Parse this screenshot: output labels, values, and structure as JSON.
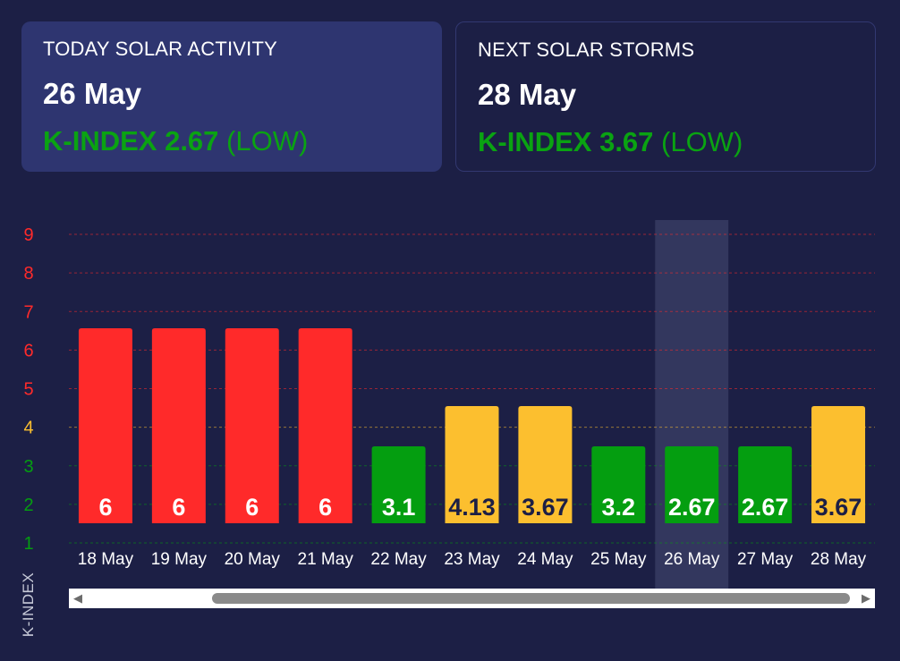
{
  "today_card": {
    "title": "TODAY SOLAR ACTIVITY",
    "date": "26 May",
    "k_label": "K-INDEX",
    "k_value": "2.67",
    "k_class": "(LOW)"
  },
  "next_card": {
    "title": "NEXT SOLAR STORMS",
    "date": "28 May",
    "k_label": "K-INDEX",
    "k_value": "3.67",
    "k_class": "(LOW)"
  },
  "colors": {
    "background": "#1c1f45",
    "card_active": "#2e3570",
    "red": "#ff2a2a",
    "yellow": "#fcbf2f",
    "green": "#049e10",
    "highlight": "#33375e"
  },
  "chart_data": {
    "type": "bar",
    "categories": [
      "18 May",
      "19 May",
      "20 May",
      "21 May",
      "22 May",
      "23 May",
      "24 May",
      "25 May",
      "26 May",
      "27 May",
      "28 May"
    ],
    "values": [
      6,
      6,
      6,
      6,
      3.1,
      4.13,
      3.67,
      3.2,
      2.67,
      2.67,
      3.67
    ],
    "value_labels": [
      "6",
      "6",
      "6",
      "6",
      "3.1",
      "4.13",
      "3.67",
      "3.2",
      "2.67",
      "2.67",
      "3.67"
    ],
    "bar_colors": [
      "red",
      "red",
      "red",
      "red",
      "green",
      "yellow",
      "yellow",
      "green",
      "green",
      "green",
      "yellow"
    ],
    "highlighted_category": "26 May",
    "ylabel": "K-INDEX",
    "yticks": [
      1,
      2,
      3,
      4,
      5,
      6,
      7,
      8,
      9
    ],
    "ytick_colors": [
      "green",
      "green",
      "green",
      "yellow",
      "red",
      "red",
      "red",
      "red",
      "red"
    ],
    "ylim": [
      1,
      9
    ],
    "grid": true
  },
  "scrollbar": {
    "left_arrow": "◀",
    "right_arrow": "▶"
  }
}
